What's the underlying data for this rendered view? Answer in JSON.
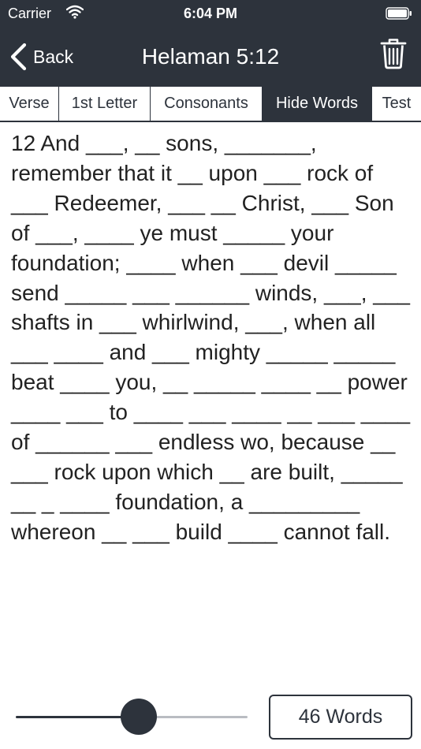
{
  "status_bar": {
    "carrier": "Carrier",
    "time": "6:04 PM"
  },
  "nav": {
    "back_label": "Back",
    "title": "Helaman 5:12"
  },
  "modes": [
    {
      "label": "Verse",
      "selected": false
    },
    {
      "label": "1st Letter",
      "selected": false
    },
    {
      "label": "Consonants",
      "selected": false
    },
    {
      "label": "Hide Words",
      "selected": true
    },
    {
      "label": "Test",
      "selected": false
    }
  ],
  "verse": {
    "text": "12 And ___, __ sons, _______, remember that it __ upon ___ rock of ___ Redeemer, ___ __ Christ, ___ Son of ___, ____ ye must _____ your foundation; ____ when ___ devil _____ send _____ ___ ______ winds, ___, ___ shafts in ___ whirlwind, ___, when all ___ ____ and ___ mighty _____ _____ beat ____ you, __ _____ ____ __ power ____ ___ to ____ ___ ____ __ ___ ____ of ______ ___ endless wo, because __ ___ rock upon which __ are built, _____ __ _ ____ foundation, a _________ whereon __ ___ build ____ cannot fall."
  },
  "slider": {
    "level": 0.53
  },
  "word_count": {
    "label": "46 Words"
  },
  "colors": {
    "bar_background": "#2d333c",
    "bar_foreground": "#ffffff",
    "slider_inactive": "#b9bcc2"
  },
  "icons": {
    "wifi": "wifi-icon",
    "battery": "battery-icon",
    "back": "chevron-left-icon",
    "trash": "trash-icon"
  }
}
